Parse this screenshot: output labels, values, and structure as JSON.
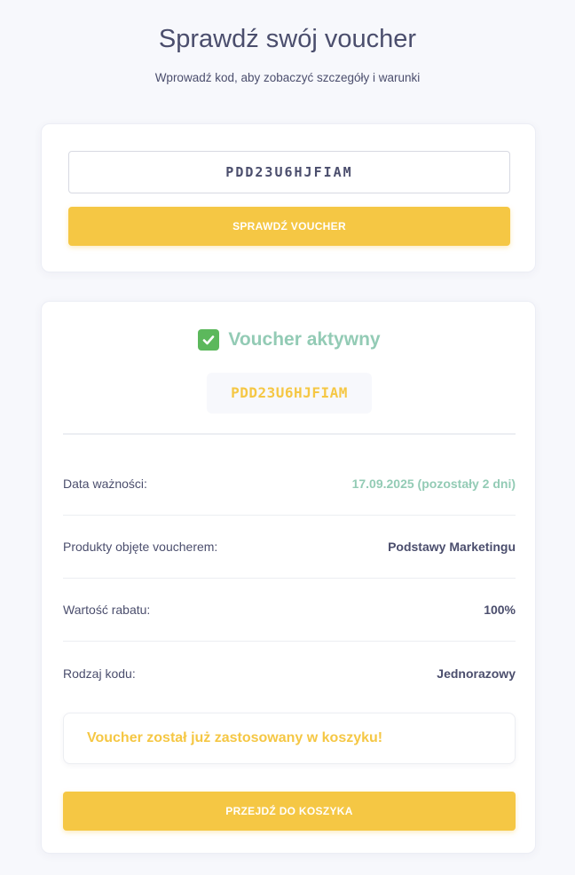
{
  "header": {
    "title": "Sprawdź swój voucher",
    "subtitle": "Wprowadź kod, aby zobaczyć szczegóły i warunki"
  },
  "search": {
    "code_value": "PDD23U6HJFIAM",
    "check_button_label": "SPRAWDŹ VOUCHER"
  },
  "result": {
    "status_icon": "check-mark-icon",
    "status_text": "Voucher aktywny",
    "code": "PDD23U6HJFIAM",
    "details": [
      {
        "label": "Data ważności:",
        "value": "17.09.2025 (pozostały 2 dni)"
      },
      {
        "label": "Produkty objęte voucherem:",
        "value": "Podstawy Marketingu"
      },
      {
        "label": "Wartość rabatu:",
        "value": "100%"
      },
      {
        "label": "Rodzaj kodu:",
        "value": "Jednorazowy"
      }
    ],
    "notice": "Voucher został już zastosowany w koszyku!",
    "cart_button_label": "PRZEJDŹ DO KOSZYKA"
  },
  "colors": {
    "accent_yellow": "#f5c744",
    "status_green": "#93cbb5",
    "check_green": "#5cb85c",
    "text_dark": "#4b4e6d",
    "background": "#f7f8fc"
  }
}
